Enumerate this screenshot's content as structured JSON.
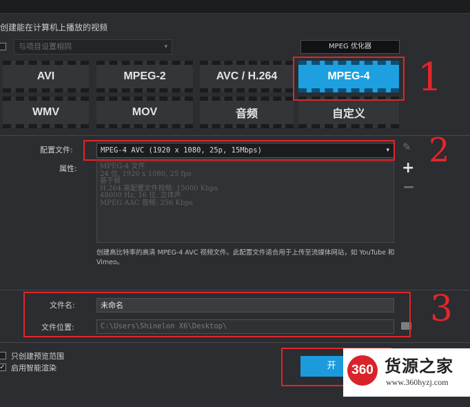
{
  "header": {
    "section_title": "创建能在计算机上播放的视频"
  },
  "preset": {
    "value": "与项目设置相同",
    "arrow": "▾"
  },
  "optimizer_label": "MPEG 优化器",
  "formats": [
    {
      "label": "AVI",
      "active": false
    },
    {
      "label": "MPEG-2",
      "active": false
    },
    {
      "label": "AVC / H.264",
      "active": false
    },
    {
      "label": "MPEG-4",
      "active": true
    },
    {
      "label": "WMV",
      "active": false
    },
    {
      "label": "MOV",
      "active": false
    },
    {
      "label": "音频",
      "active": false
    },
    {
      "label": "自定义",
      "active": false
    }
  ],
  "profile": {
    "label": "配置文件:",
    "value": "MPEG-4 AVC (1920 x 1080, 25p, 15Mbps)",
    "arrow": "▾"
  },
  "properties": {
    "label": "属性:",
    "lines": [
      "MPEG-4 文件",
      "24 位, 1920 x 1080, 25 fps",
      "基于帧",
      "H.264 高配置文件视频: 15000 Kbps",
      "48000 Hz, 16 位, 立体声",
      "MPEG AAC 音频: 256 Kbps"
    ]
  },
  "side_icons": {
    "edit": "✎",
    "add": "+",
    "remove": "−"
  },
  "description": "创建高比特率的高清 MPEG-4 AVC 视频文件。此配置文件适合用于上传至流媒体网站，如 YouTube 和 Vimeo。",
  "file": {
    "name_label": "文件名:",
    "name_value": "未命名",
    "location_label": "文件位置:",
    "location_value": "C:\\Users\\Shinelon X6\\Desktop\\"
  },
  "options": {
    "preview_only": "只创建预览范围",
    "smart_render": "启用智能渲染"
  },
  "start_button": "开",
  "annotations": {
    "one": "1",
    "two": "2",
    "three": "3",
    "color": "#e2262a"
  },
  "watermark": {
    "logo": "360",
    "name": "货源之家",
    "url": "www.360hyzj.com"
  },
  "accent_color": "#1ea0e0"
}
